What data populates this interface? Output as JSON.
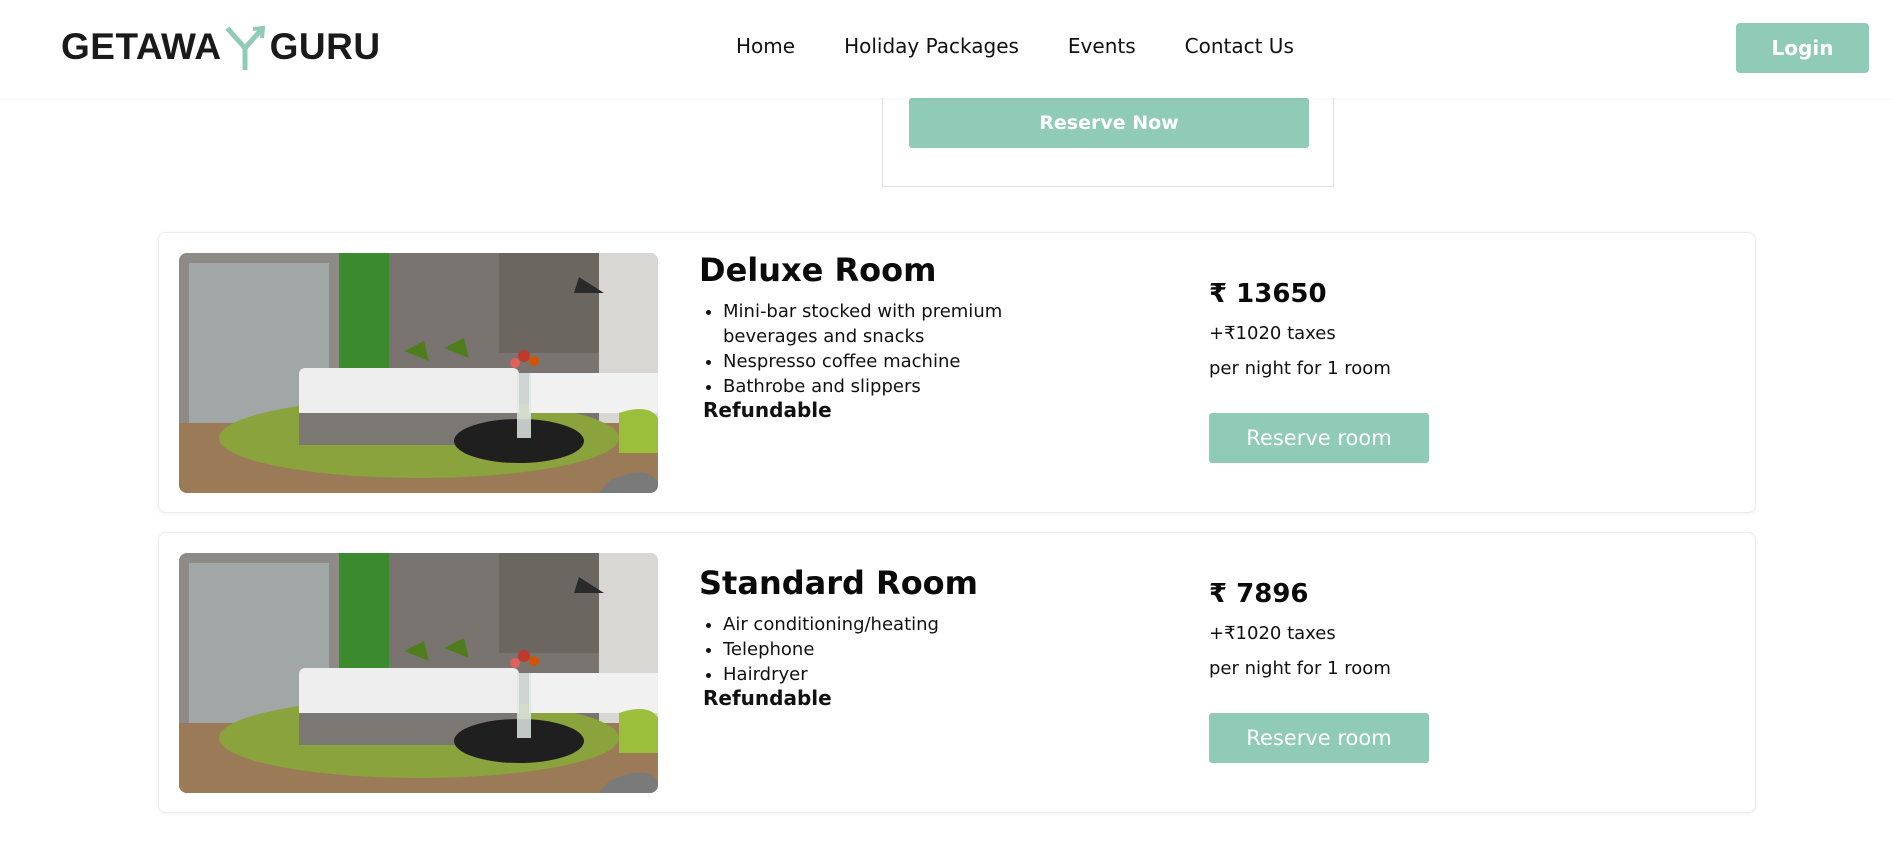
{
  "header": {
    "logo": {
      "left": "GETAWA",
      "right": "GURU"
    },
    "nav": [
      "Home",
      "Holiday Packages",
      "Events",
      "Contact Us"
    ],
    "login_label": "Login"
  },
  "top_card": {
    "reserve_now_label": "Reserve Now"
  },
  "rooms": [
    {
      "title": "Deluxe Room",
      "features": [
        "Mini-bar stocked with premium beverages and snacks",
        "Nespresso coffee machine",
        "Bathrobe and slippers"
      ],
      "refundable": "Refundable",
      "price": "₹ 13650",
      "taxes": "+₹1020 taxes",
      "per_night": "per night for 1 room",
      "reserve_label": "Reserve room"
    },
    {
      "title": "Standard Room",
      "features": [
        "Air conditioning/heating",
        "Telephone",
        "Hairdryer"
      ],
      "refundable": "Refundable",
      "price": "₹ 7896",
      "taxes": "+₹1020 taxes",
      "per_night": "per night for 1 room",
      "reserve_label": "Reserve room"
    }
  ],
  "colors": {
    "accent": "#8fcbb6",
    "text": "#111111",
    "card_border": "#ececec"
  }
}
